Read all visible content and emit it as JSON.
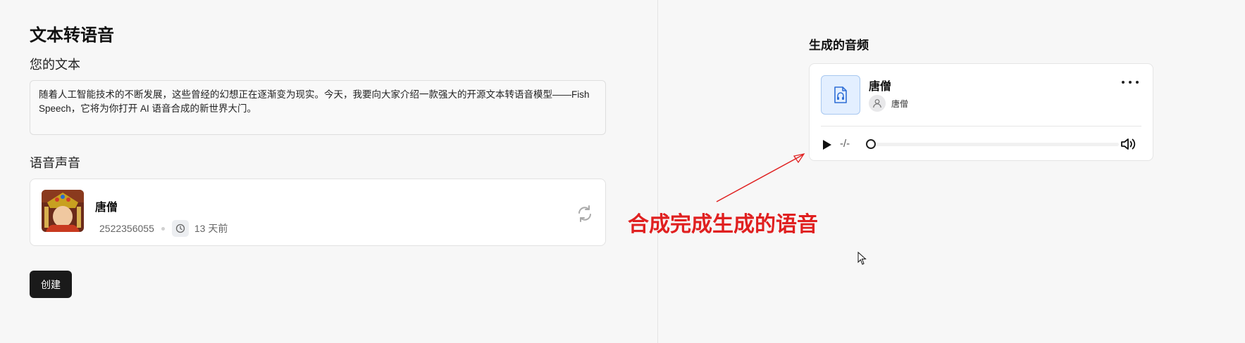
{
  "left": {
    "page_title": "文本转语音",
    "text_label": "您的文本",
    "text_value": "随着人工智能技术的不断发展，这些曾经的幻想正在逐渐变为现实。今天，我要向大家介绍一款强大的开源文本转语音模型——Fish Speech，它将为你打开 AI 语音合成的新世界大门。",
    "voice_label": "语音声音",
    "voice": {
      "name": "唐僧",
      "id": "2522356055",
      "time": "13 天前",
      "avatar_icon": "avatar-image",
      "clock_icon": "clock-icon",
      "refresh_icon": "refresh-icon"
    },
    "create_label": "创建"
  },
  "right": {
    "title": "生成的音频",
    "audio": {
      "name": "唐僧",
      "user": "唐僧",
      "time": "-/-",
      "progress": 0
    }
  },
  "annotation": {
    "text": "合成完成生成的语音",
    "color": "#e02020"
  },
  "colors": {
    "button_bg": "#1a1a1a",
    "audio_icon_bg": "#e3efff",
    "audio_icon_border": "#a8c8f0",
    "accent_blue": "#2f6fd6"
  }
}
